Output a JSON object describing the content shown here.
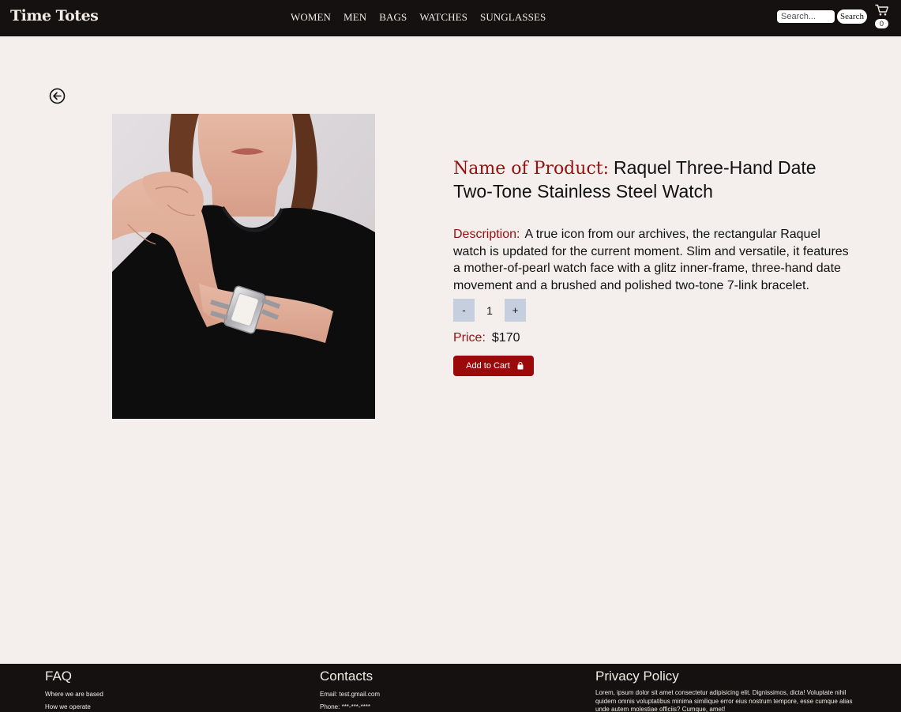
{
  "brand": "Time Totes",
  "nav": {
    "links": [
      "WOMEN",
      "MEN",
      "BAGS",
      "WATCHES",
      "SUNGLASSES"
    ],
    "search_placeholder": "Search...",
    "search_label": "Search",
    "cart_count": "0"
  },
  "product": {
    "name_label": "Name of Product:",
    "name": "Raquel Three-Hand Date Two-Tone Stainless Steel Watch",
    "description_label": "Description:",
    "description": "A true icon from our archives, the rectangular Raquel watch is updated for the current moment. Slim and versatile, it features a mother-of-pearl watch face with a glitz inner-frame, three-hand date movement and a brushed and polished two-tone 7-link bracelet.",
    "quantity_decrease": "-",
    "quantity": "1",
    "quantity_increase": "+",
    "price_label": "Price:",
    "price": "$170",
    "add_to_cart_label": "Add to Cart"
  },
  "footer": {
    "faq": {
      "heading": "FAQ",
      "items": [
        "Where we are based",
        "How we operate"
      ]
    },
    "contacts": {
      "heading": "Contacts",
      "items": [
        "Email: test.gmail.com",
        "Phone: ***-***-****"
      ]
    },
    "privacy": {
      "heading": "Privacy Policy",
      "text": "Lorem, ipsum dolor sit amet consectetur adipisicing elit. Dignissimos, dicta! Voluptate nihil quidem omnis voluptatibus minima similique error eius nostrum tempore, esse cumque alias unde autem molestiae officiis? Cumque, amet!"
    }
  },
  "colors": {
    "header_bg": "#151110",
    "page_bg": "#f4efed",
    "accent": "#9a0e0e",
    "qty_button": "#c5cfde"
  },
  "icons": [
    "cart-icon",
    "back-arrow-icon",
    "shopping-bag-icon"
  ]
}
